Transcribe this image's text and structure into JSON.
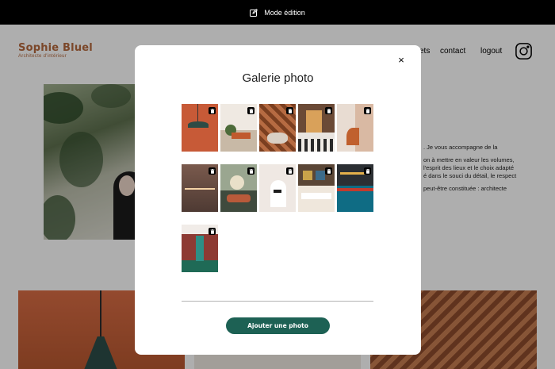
{
  "edit_bar": {
    "label": "Mode édition",
    "icon": "edit-icon"
  },
  "header": {
    "logo_name": "Sophie Bluel",
    "logo_subtitle": "Architecte d'intérieur",
    "nav_partial_projects": "ets",
    "nav_contact": "contact",
    "nav_logout": "logout",
    "instagram_icon": "instagram-icon"
  },
  "about": {
    "line1": ". Je vous accompagne de la",
    "line2": "on à mettre en valeur les volumes,",
    "line3": "l'esprit des lieux et le choix adapté",
    "line4": "é dans le souci du détail, le respect",
    "line5": "peut-être constituée : architecte"
  },
  "modal": {
    "title": "Galerie photo",
    "close_label": "×",
    "add_button_label": "Ajouter une photo",
    "photos": [
      {
        "name": "photo-1",
        "icon": "trash-icon"
      },
      {
        "name": "photo-2",
        "icon": "trash-icon"
      },
      {
        "name": "photo-3",
        "icon": "trash-icon"
      },
      {
        "name": "photo-4",
        "icon": "trash-icon"
      },
      {
        "name": "photo-5",
        "icon": "trash-icon"
      },
      {
        "name": "photo-6",
        "icon": "trash-icon"
      },
      {
        "name": "photo-7",
        "icon": "trash-icon"
      },
      {
        "name": "photo-8",
        "icon": "trash-icon"
      },
      {
        "name": "photo-9",
        "icon": "trash-icon"
      },
      {
        "name": "photo-10",
        "icon": "trash-icon"
      },
      {
        "name": "photo-11",
        "icon": "trash-icon"
      }
    ]
  },
  "colors": {
    "accent_green": "#1d6154",
    "brand_terracotta": "#b1663c",
    "edit_bar": "#000000"
  }
}
